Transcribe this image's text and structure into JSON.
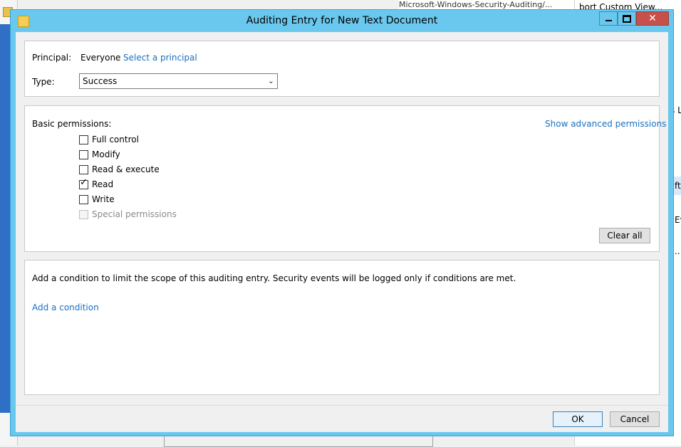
{
  "background": {
    "right_pane_rows": [
      "bort Custom View...",
      "s L",
      "ft",
      "Ev",
      "..."
    ],
    "top_strip_text": "Microsoft-Windows-Security-Auditing/...",
    "top_buttons": [
      "□",
      "x"
    ]
  },
  "dialog": {
    "title": "Auditing Entry for New Text Document",
    "principal": {
      "label": "Principal:",
      "value": "Everyone",
      "link": "Select a principal"
    },
    "type": {
      "label": "Type:",
      "selected": "Success"
    },
    "permissions": {
      "label": "Basic permissions:",
      "advanced_link": "Show advanced permissions",
      "items": [
        {
          "label": "Full control",
          "checked": false,
          "disabled": false
        },
        {
          "label": "Modify",
          "checked": false,
          "disabled": false
        },
        {
          "label": "Read & execute",
          "checked": false,
          "disabled": false
        },
        {
          "label": "Read",
          "checked": true,
          "disabled": false
        },
        {
          "label": "Write",
          "checked": false,
          "disabled": false
        },
        {
          "label": "Special permissions",
          "checked": false,
          "disabled": true
        }
      ],
      "clear_all": "Clear all"
    },
    "condition": {
      "description": "Add a condition to limit the scope of this auditing entry. Security events will be logged only if conditions are met.",
      "add_link": "Add a condition"
    },
    "buttons": {
      "ok": "OK",
      "cancel": "Cancel"
    }
  }
}
